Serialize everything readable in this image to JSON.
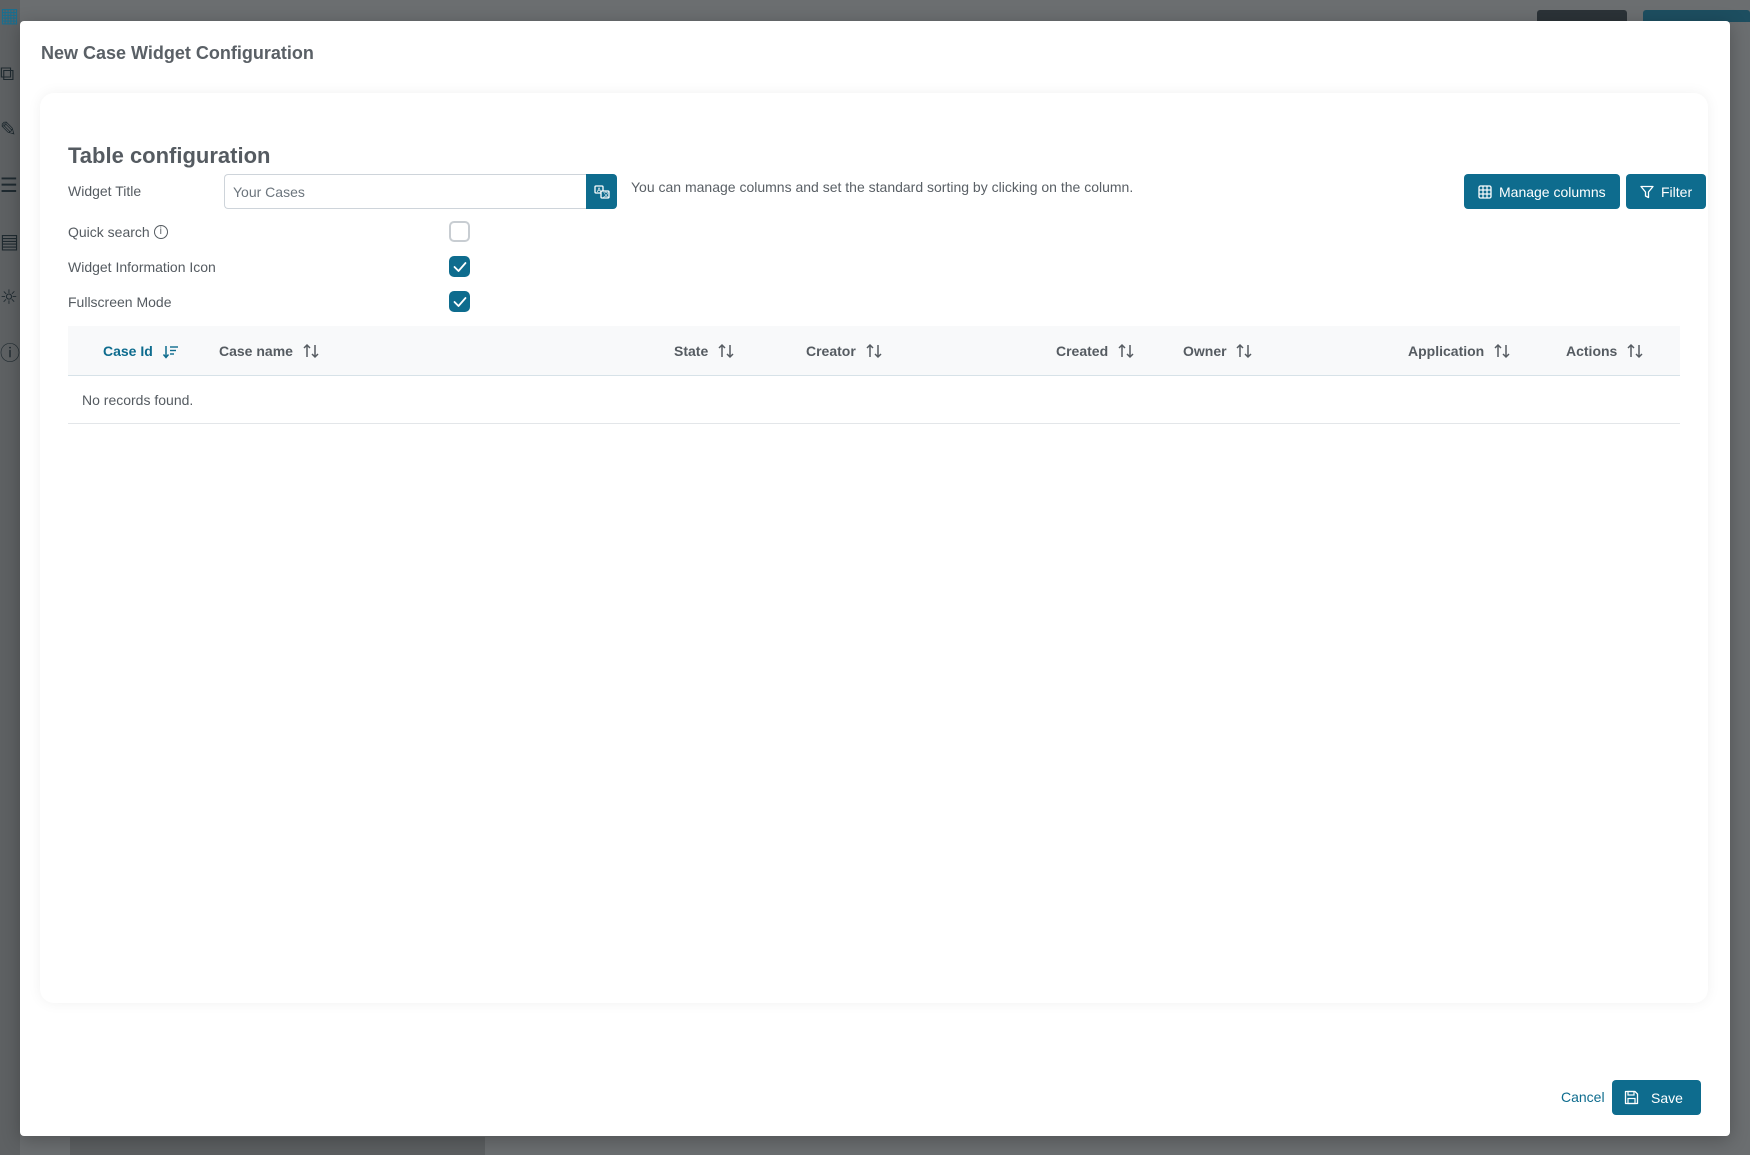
{
  "dialog": {
    "title": "New Case Widget Configuration"
  },
  "card": {
    "title": "Table configuration",
    "widget_title_label": "Widget Title",
    "widget_title_value": "Your Cases",
    "hint": "You can manage columns and set the standard sorting by clicking on the column.",
    "manage_columns_label": "Manage columns",
    "filter_label": "Filter",
    "options": [
      {
        "label": "Quick search",
        "checked": false,
        "info_icon": true
      },
      {
        "label": "Widget Information Icon",
        "checked": true
      },
      {
        "label": "Fullscreen Mode",
        "checked": true
      }
    ]
  },
  "table": {
    "columns": [
      {
        "label": "Case Id",
        "sort": "active-desc"
      },
      {
        "label": "Case name",
        "sort": "none"
      },
      {
        "label": "State",
        "sort": "none"
      },
      {
        "label": "Creator",
        "sort": "none"
      },
      {
        "label": "Created",
        "sort": "none"
      },
      {
        "label": "Owner",
        "sort": "none"
      },
      {
        "label": "Application",
        "sort": "none"
      },
      {
        "label": "Actions",
        "sort": "none"
      }
    ],
    "empty_message": "No records found."
  },
  "footer": {
    "cancel_label": "Cancel",
    "save_label": "Save"
  },
  "colors": {
    "primary": "#0e6c8e",
    "overlay": "#6b6e70"
  }
}
